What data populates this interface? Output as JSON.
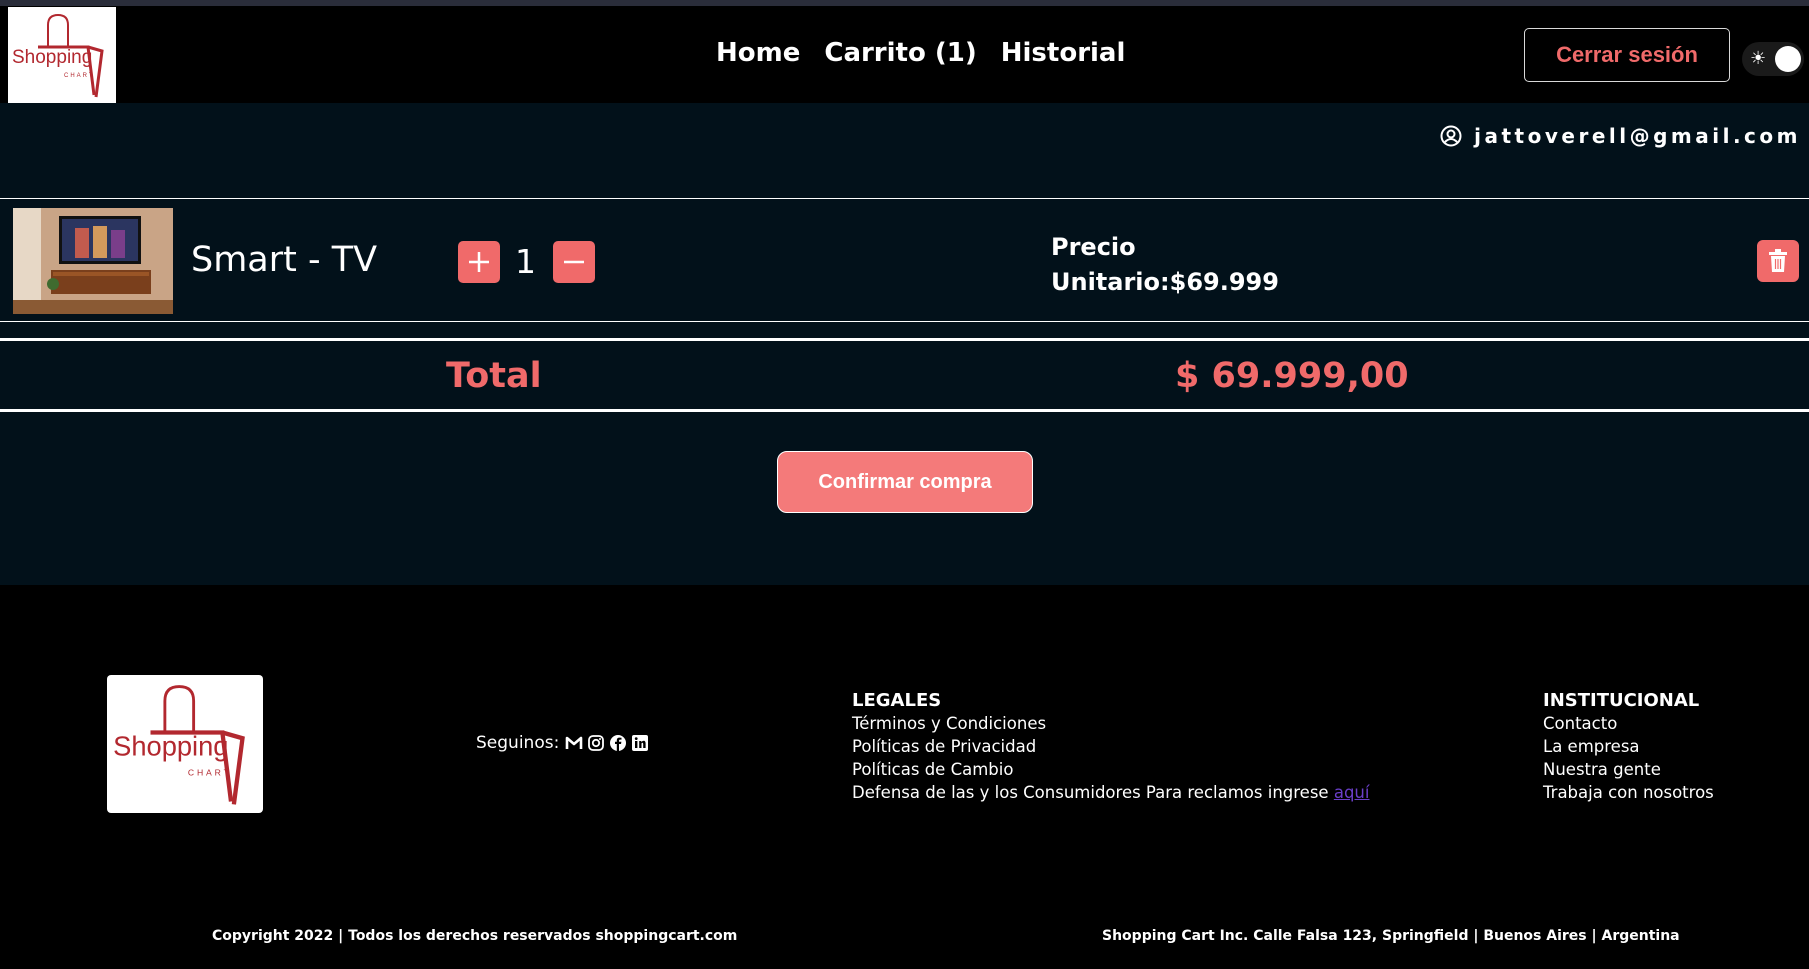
{
  "header": {
    "logo_text": "Shopping",
    "logo_subtext": "CHART",
    "nav": [
      "Home",
      "Carrito (1)",
      "Historial"
    ],
    "logout_label": "Cerrar sesión",
    "theme_toggle_icon": "sun-icon"
  },
  "user": {
    "email": "jattoverell@gmail.com",
    "icon": "user-circle-icon"
  },
  "cart": {
    "items": [
      {
        "name": "Smart - TV",
        "quantity": "1",
        "price_label_line1": "Precio",
        "price_label_line2": "Unitario:$69.999"
      }
    ],
    "total_label": "Total",
    "total_value": "$ 69.999,00",
    "confirm_label": "Confirmar compra"
  },
  "footer": {
    "follow_label": "Seguinos:",
    "social_icons": [
      "gmail-icon",
      "instagram-icon",
      "facebook-icon",
      "linkedin-icon"
    ],
    "legales": {
      "title": "LEGALES",
      "links": [
        "Términos y Condiciones",
        "Políticas de Privacidad",
        "Políticas de Cambio"
      ],
      "consumer_text": "Defensa de las y los Consumidores Para reclamos ingrese ",
      "consumer_link": "aquí"
    },
    "institucional": {
      "title": "INSTITUCIONAL",
      "links": [
        "Contacto",
        "La empresa",
        "Nuestra gente",
        "Trabaja con nosotros"
      ]
    },
    "copyright_left": "Copyright 2022 | Todos los derechos reservados shoppingcart.com",
    "copyright_right": "Shopping Cart Inc. Calle Falsa 123, Springfield | Buenos Aires | Argentina"
  },
  "colors": {
    "accent": "#f06a6a",
    "page_bg": "#02111a",
    "nav_bg": "#000000"
  }
}
